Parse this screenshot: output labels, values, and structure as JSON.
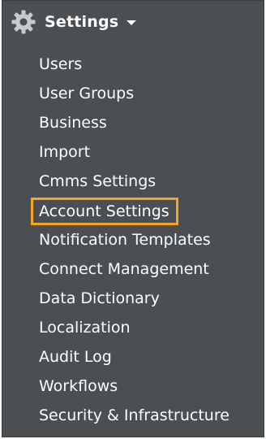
{
  "header": {
    "title": "Settings",
    "icon": "gear-icon",
    "dropdown_icon": "chevron-down-icon"
  },
  "menu": {
    "items": [
      {
        "label": "Users"
      },
      {
        "label": "User Groups"
      },
      {
        "label": "Business"
      },
      {
        "label": "Import"
      },
      {
        "label": "Cmms Settings"
      },
      {
        "label": "Account Settings",
        "active": true
      },
      {
        "label": "Notification Templates"
      },
      {
        "label": "Connect Management"
      },
      {
        "label": "Data Dictionary"
      },
      {
        "label": "Localization"
      },
      {
        "label": "Audit Log"
      },
      {
        "label": "Workflows"
      },
      {
        "label": "Security & Infrastructure"
      }
    ]
  },
  "colors": {
    "panel_background": "#4b4f52",
    "text": "#ffffff",
    "highlight_border": "#f5a623"
  }
}
